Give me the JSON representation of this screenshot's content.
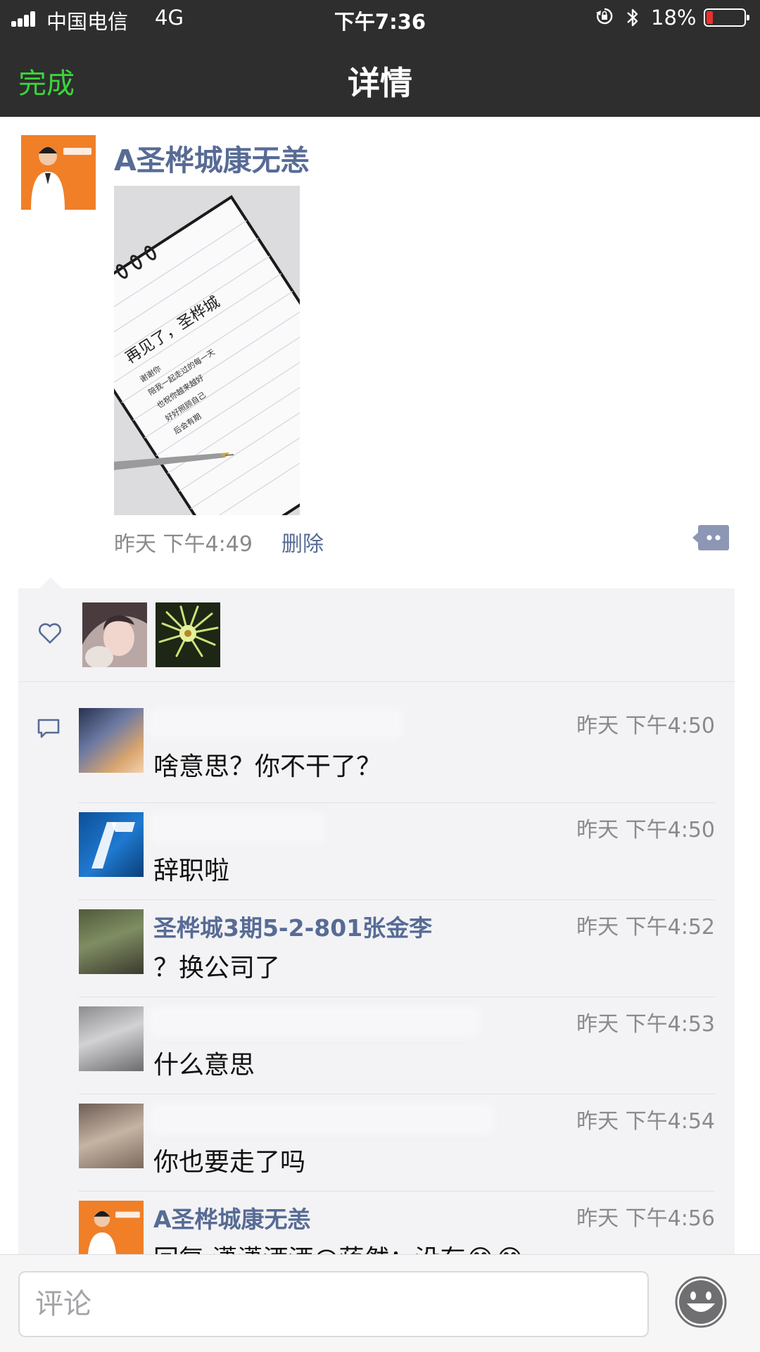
{
  "status_bar": {
    "carrier": "中国电信",
    "network": "4G",
    "time": "下午7:36",
    "battery": "18%",
    "battery_level": 0.18
  },
  "nav": {
    "done_label": "完成",
    "title": "详情"
  },
  "post": {
    "author": "A圣桦城康无恙",
    "time": "昨天 下午4:49",
    "delete_label": "删除",
    "photo_text": {
      "heading": "再见了，圣桦城",
      "lines": [
        "谢谢你",
        "陪我一起走过的每一天",
        "也祝你越来越好",
        "好好照顾自己",
        "后会有期"
      ]
    }
  },
  "likes": {
    "count": 2
  },
  "comments": [
    {
      "name": "",
      "time": "昨天 下午4:50",
      "text": "啥意思？你不干了？"
    },
    {
      "name": "",
      "time": "昨天 下午4:50",
      "text": "辞职啦"
    },
    {
      "name": "圣桦城3期5-2-801张金李",
      "time": "昨天 下午4:52",
      "text": "？换公司了"
    },
    {
      "name": "",
      "time": "昨天 下午4:53",
      "text": "什么意思"
    },
    {
      "name": "",
      "time": "昨天 下午4:54",
      "text": "你也要走了吗"
    },
    {
      "name": "A圣桦城康无恙",
      "time": "昨天 下午4:56",
      "text": "回复 潇潇洒洒@蒋然：没有😂😂"
    }
  ],
  "comment_bar": {
    "placeholder": "评论"
  },
  "colors": {
    "nav_bg": "#2e2e2e",
    "accent_green": "#3dd33d",
    "link_blue": "#576b95",
    "panel_bg": "#f3f3f5",
    "avatar_orange": "#f07f28"
  },
  "icons": [
    "signal-icon",
    "rotation-lock-icon",
    "bluetooth-icon",
    "battery-icon",
    "comment-action-icon",
    "heart-icon",
    "comment-bubble-icon",
    "emoji-icon"
  ]
}
